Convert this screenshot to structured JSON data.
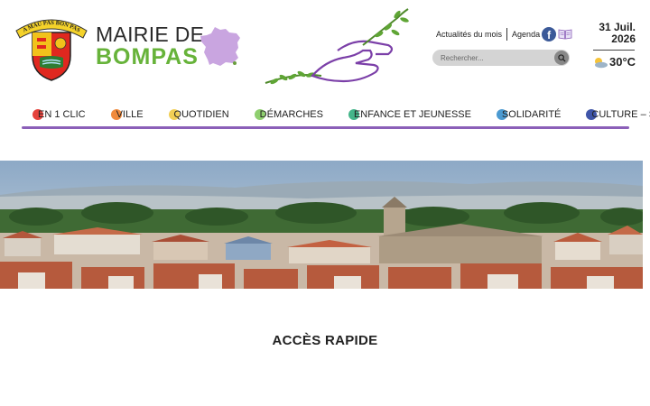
{
  "header": {
    "crest_motto": "A MAU PAS BON PAS",
    "title_line1": "MAIRIE DE",
    "title_line2": "BOMPAS"
  },
  "top_links": {
    "news": "Actualités du mois",
    "agenda": "Agenda",
    "facebook_icon": "f"
  },
  "search": {
    "placeholder": "Rechercher..."
  },
  "date": {
    "day": "31 Juil.",
    "year": "2026"
  },
  "weather": {
    "temperature": "30°C",
    "icon": "sun-cloud-icon"
  },
  "nav": {
    "items": [
      {
        "label": "EN 1 CLIC",
        "dot_color": "#e5433d"
      },
      {
        "label": "VILLE",
        "dot_color": "#f08a3c"
      },
      {
        "label": "QUOTIDIEN",
        "dot_color": "#f2cf55"
      },
      {
        "label": "DÉMARCHES",
        "dot_color": "#8fcf6f"
      },
      {
        "label": "ENFANCE ET JEUNESSE",
        "dot_color": "#44b58a"
      },
      {
        "label": "SOLIDARITÉ",
        "dot_color": "#4b9ad1"
      },
      {
        "label": "CULTURE – SPORT",
        "dot_color": "#3f55a8"
      }
    ],
    "accent_color": "#8b5fb8"
  },
  "main": {
    "section_title": "ACCÈS RAPIDE"
  },
  "colors": {
    "brand_green": "#67b33a",
    "accent_purple": "#8b5fb8",
    "map_lilac": "#c9a5e0"
  }
}
